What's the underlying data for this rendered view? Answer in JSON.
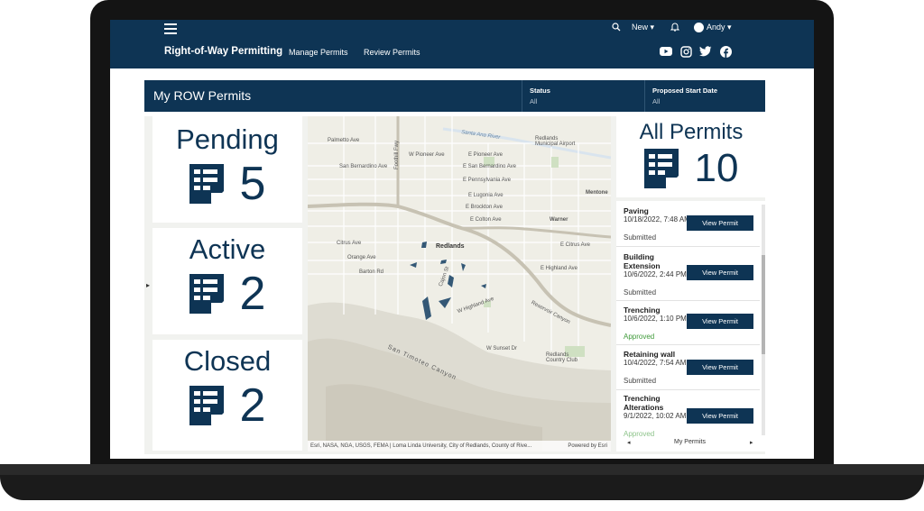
{
  "header": {
    "util": {
      "new_label": "New ▾",
      "user_name": "Andy ▾"
    },
    "app_title": "Right-of-Way Permitting",
    "nav": [
      "Manage Permits",
      "Review Permits"
    ],
    "social_icons": [
      "youtube-icon",
      "instagram-icon",
      "twitter-icon",
      "facebook-icon"
    ]
  },
  "filter": {
    "title": "My ROW Permits",
    "status_label": "Status",
    "status_value": "All",
    "start_label": "Proposed Start Date",
    "start_value": "All"
  },
  "cards": {
    "pending": {
      "title": "Pending",
      "count": "5"
    },
    "active": {
      "title": "Active",
      "count": "2"
    },
    "closed": {
      "title": "Closed",
      "count": "2"
    },
    "all": {
      "title": "All Permits",
      "count": "10"
    }
  },
  "map": {
    "labels": [
      "Palmetto Ave",
      "Foothill Fwy",
      "Redlands Municipal Airport",
      "W Pioneer Ave",
      "E Pioneer Ave",
      "San Bernardino Ave",
      "E San Bernardino Ave",
      "E Pennsylvania Ave",
      "Mentone",
      "E Lugonia Ave",
      "E Brockton Ave",
      "Warner",
      "E Colton Ave",
      "Redlands",
      "Citrus Ave",
      "E Citrus Ave",
      "Orange Ave",
      "E Highland Ave",
      "Barton Rd",
      "W Highland Ave",
      "Cajon St",
      "W Sunset Dr",
      "Redlands Country Club",
      "Santa Ana River",
      "San Timoteo Canyon",
      "Reservoir Canyon"
    ],
    "attribution": "Esri, NASA, NGA, USGS, FEMA | Loma Linda University, City of Redlands, County of Rive...",
    "powered": "Powered by Esri"
  },
  "permits": {
    "items": [
      {
        "title": "Paving",
        "date": "10/18/2022, 7:48 AM",
        "status": "Submitted",
        "button": "View Permit"
      },
      {
        "title": "Building Extension",
        "date": "10/6/2022, 2:44 PM",
        "status": "Submitted",
        "button": "View Permit"
      },
      {
        "title": "Trenching",
        "date": "10/6/2022, 1:10 PM",
        "status": "Approved",
        "button": "View Permit"
      },
      {
        "title": "Retaining wall",
        "date": "10/4/2022, 7:54 AM",
        "status": "Submitted",
        "button": "View Permit"
      },
      {
        "title": "Trenching Alterations",
        "date": "9/1/2022, 10:02 AM",
        "status": "Approved",
        "button": "View Permit"
      }
    ],
    "footer_label": "My Permits",
    "prev": "◂",
    "next": "▸"
  },
  "colors": {
    "navy": "#0e3454",
    "approved": "#3f9a3a",
    "submitted": "#444444"
  }
}
